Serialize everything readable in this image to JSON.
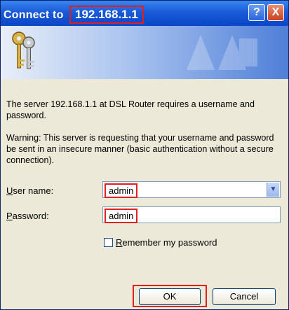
{
  "dialog": {
    "title_prefix": "Connect to",
    "title_ip": "192.168.1.1",
    "help_label": "?",
    "close_label": "X"
  },
  "message": {
    "line1": "The server 192.168.1.1 at DSL Router requires a username and password.",
    "line2": "Warning: This server is requesting that your username and password be sent in an insecure manner (basic authentication without a secure connection)."
  },
  "form": {
    "user_label_u": "U",
    "user_label_rest": "ser name:",
    "user_value": "admin",
    "pass_label_u": "P",
    "pass_label_rest": "assword:",
    "pass_value": "admin",
    "remember_u": "R",
    "remember_rest": "emember my password",
    "remember_checked": false
  },
  "buttons": {
    "ok": "OK",
    "cancel": "Cancel"
  },
  "icons": [
    "keys-icon",
    "help-icon",
    "close-icon",
    "chevron-down-icon"
  ],
  "colors": {
    "titlebar": "#0a46c8",
    "highlight": "#e0201e"
  }
}
